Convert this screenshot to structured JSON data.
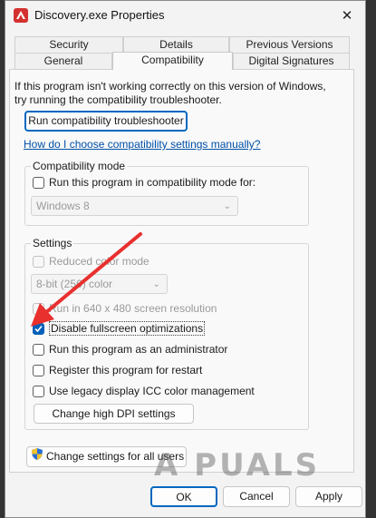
{
  "window": {
    "title": "Discovery.exe Properties",
    "close_glyph": "✕"
  },
  "tabs": {
    "row1": [
      "Security",
      "Details",
      "Previous Versions"
    ],
    "row2": [
      "General",
      "Compatibility",
      "Digital Signatures"
    ],
    "active": "Compatibility"
  },
  "intro": {
    "line1": "If this program isn't working correctly on this version of Windows,",
    "line2": "try running the compatibility troubleshooter."
  },
  "troubleshooter_button": "Run compatibility troubleshooter",
  "help_link": "How do I choose compatibility settings manually?",
  "compat_mode": {
    "title": "Compatibility mode",
    "checkbox_label": "Run this program in compatibility mode for:",
    "checked": false,
    "select_value": "Windows 8"
  },
  "settings": {
    "title": "Settings",
    "reduced_color": {
      "label": "Reduced color mode",
      "checked": false,
      "disabled": true
    },
    "color_select": "8-bit (256) color",
    "run_640": {
      "label": "Run in 640 x 480 screen resolution",
      "checked": false,
      "disabled": true
    },
    "disable_fullscreen": {
      "label": "Disable fullscreen optimizations",
      "checked": true
    },
    "run_admin": {
      "label": "Run this program as an administrator",
      "checked": false
    },
    "register_restart": {
      "label": "Register this program for restart",
      "checked": false
    },
    "legacy_icc": {
      "label": "Use legacy display ICC color management",
      "checked": false
    },
    "dpi_button": "Change high DPI settings"
  },
  "change_all_button": "Change settings for all users",
  "footer": {
    "ok": "OK",
    "cancel": "Cancel",
    "apply": "Apply"
  },
  "watermark": "A PUALS",
  "colors": {
    "accent": "#005fb8",
    "arrow": "#e8302e",
    "link": "#0050a8"
  }
}
